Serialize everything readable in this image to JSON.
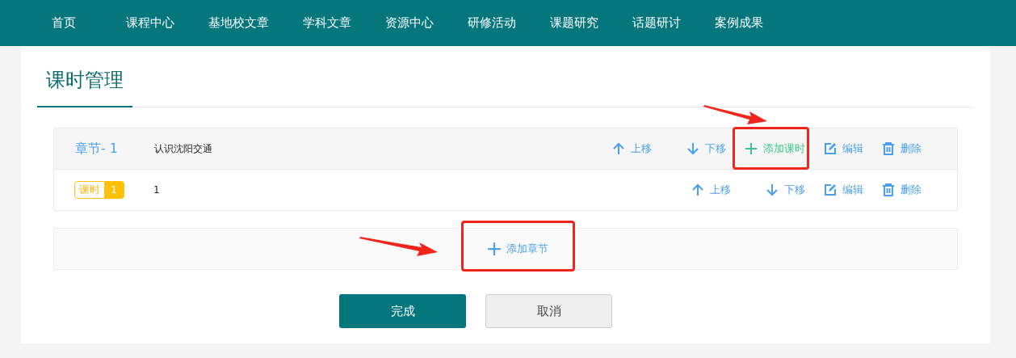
{
  "nav": {
    "items": [
      "首页",
      "课程中心",
      "基地校文章",
      "学科文章",
      "资源中心",
      "研修活动",
      "课题研究",
      "话题研讨",
      "案例成果"
    ]
  },
  "page_title": "课时管理",
  "chapters": [
    {
      "label": "章节- 1",
      "title": "认识沈阳交通",
      "actions": [
        {
          "kind": "up",
          "label": "上移",
          "highlighted": false
        },
        {
          "kind": "down",
          "label": "下移",
          "highlighted": false
        },
        {
          "kind": "add",
          "label": "添加课时",
          "highlighted": true
        },
        {
          "kind": "edit",
          "label": "编辑",
          "highlighted": false
        },
        {
          "kind": "delete",
          "label": "删除",
          "highlighted": false
        }
      ],
      "lessons": [
        {
          "badge_label": "课时",
          "badge_number": "1",
          "title": "1",
          "actions": [
            {
              "kind": "up",
              "label": "上移",
              "highlighted": false
            },
            {
              "kind": "down",
              "label": "下移",
              "highlighted": false
            },
            {
              "kind": "edit",
              "label": "编辑",
              "highlighted": false
            },
            {
              "kind": "delete",
              "label": "删除",
              "highlighted": false
            }
          ]
        }
      ]
    }
  ],
  "add_chapter": {
    "label": "添加章节",
    "highlighted": true
  },
  "buttons": [
    {
      "kind": "primary",
      "label": "完成"
    },
    {
      "kind": "secondary",
      "label": "取消"
    }
  ]
}
